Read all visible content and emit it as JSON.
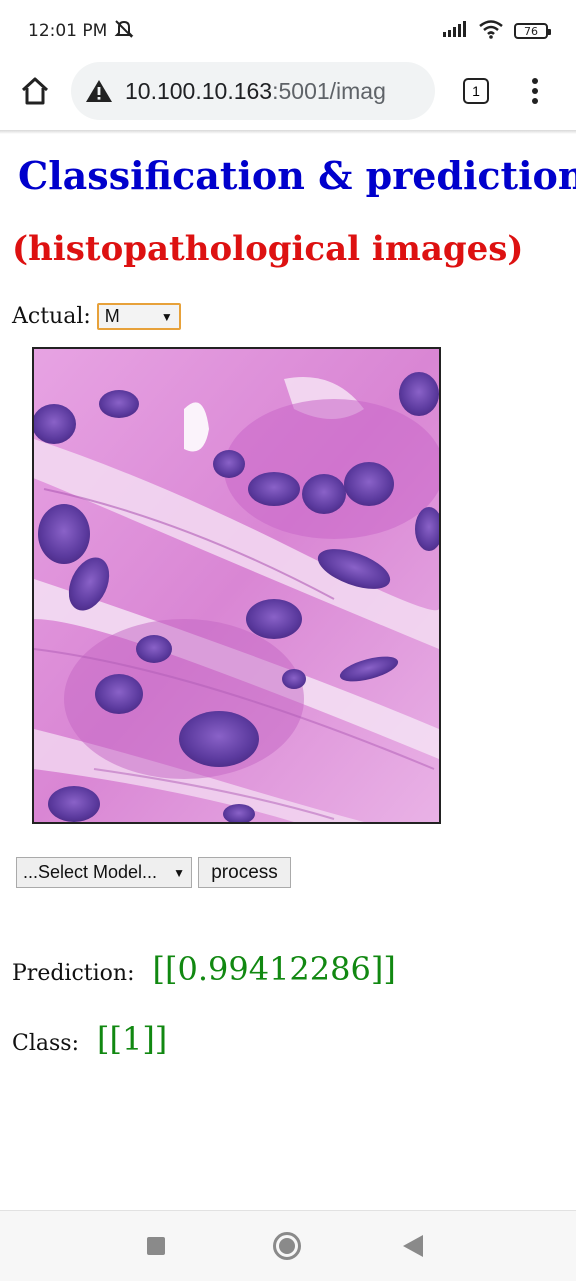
{
  "status_bar": {
    "time": "12:01 PM",
    "battery": "76",
    "icons": [
      "mute-notifications-icon",
      "signal-icon",
      "wifi-icon",
      "battery-icon"
    ]
  },
  "browser": {
    "url_host": "10.100.10.163",
    "url_path": ":5001/imag",
    "tab_count": "1",
    "icons": [
      "home-icon",
      "not-secure-warning-icon",
      "tabs-icon",
      "menu-icon"
    ]
  },
  "page": {
    "title": "Classification & prediction",
    "subtitle": "(histopathological images)",
    "actual_label": "Actual:",
    "actual_value": "M",
    "model_select_value": "...Select Model...",
    "process_label": "process",
    "prediction_label": "Prediction:",
    "prediction_value": "[[0.99412286]]",
    "class_label": "Class:",
    "class_value": "[[1]]"
  },
  "colors": {
    "title": "#0000cc",
    "subtitle": "#dd1111",
    "result": "#118811",
    "actual_border": "#e7a13a"
  },
  "nav_bar": {
    "icons": [
      "recent-apps-icon",
      "home-circle-icon",
      "back-icon"
    ]
  }
}
